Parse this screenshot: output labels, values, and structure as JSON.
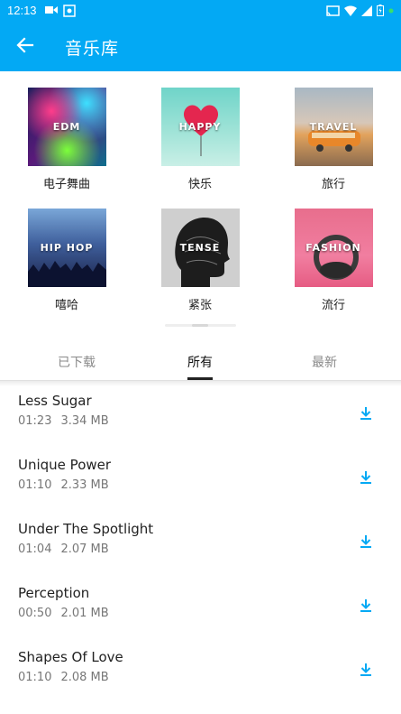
{
  "status_bar": {
    "time": "12:13",
    "icons": [
      "video-icon",
      "screenshot-icon",
      "cast-icon",
      "wifi-icon",
      "signal-icon",
      "battery-icon",
      "notification-dot-icon"
    ]
  },
  "app_bar": {
    "title": "音乐库",
    "back_icon": "arrow-left-icon",
    "color": "#03a9f4"
  },
  "genres": [
    {
      "thumb_text": "EDM",
      "label": "电子舞曲"
    },
    {
      "thumb_text": "HAPPY",
      "label": "快乐"
    },
    {
      "thumb_text": "TRAVEL",
      "label": "旅行"
    },
    {
      "thumb_text": "HIP HOP",
      "label": "嘻哈"
    },
    {
      "thumb_text": "TENSE",
      "label": "紧张"
    },
    {
      "thumb_text": "FASHION",
      "label": "流行"
    }
  ],
  "tabs": [
    {
      "label": "已下载",
      "active": false
    },
    {
      "label": "所有",
      "active": true
    },
    {
      "label": "最新",
      "active": false
    }
  ],
  "tracks": [
    {
      "title": "Less Sugar",
      "duration": "01:23",
      "size": "3.34 MB"
    },
    {
      "title": "Unique Power",
      "duration": "01:10",
      "size": "2.33 MB"
    },
    {
      "title": "Under The Spotlight",
      "duration": "01:04",
      "size": "2.07 MB"
    },
    {
      "title": "Perception",
      "duration": "00:50",
      "size": "2.01 MB"
    },
    {
      "title": "Shapes Of Love",
      "duration": "01:10",
      "size": "2.08 MB"
    }
  ],
  "accent_color": "#03a9f4"
}
